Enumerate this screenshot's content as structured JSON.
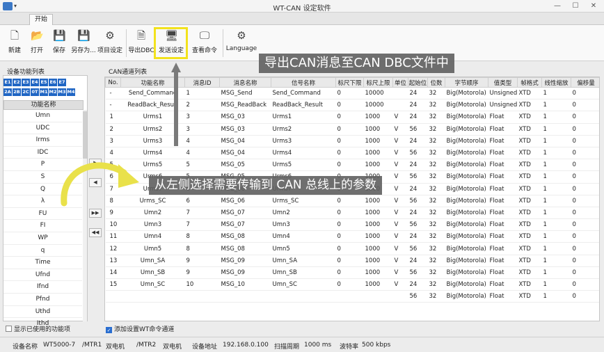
{
  "window": {
    "title": "WT-CAN 设定软件",
    "min": "—",
    "max": "☐",
    "close": "✕"
  },
  "tabs": [
    {
      "label": "开始"
    }
  ],
  "toolbar": {
    "new": "新建",
    "open": "打开",
    "save": "保存",
    "save_as": "另存为...",
    "project_settings": "项目设定",
    "export_dbc": "导出DBC",
    "send_settings": "发送设定",
    "view_commands": "查看命令",
    "language": "Language"
  },
  "left_panel": {
    "title": "设备功能列表",
    "badges": [
      "E1",
      "E2",
      "E3",
      "E4",
      "E5",
      "E6",
      "E7",
      "2A",
      "2B",
      "2C",
      "0T",
      "M1",
      "M2",
      "M3",
      "M4"
    ],
    "column_header": "功能名称",
    "items": [
      "Umn",
      "UDC",
      "Irms",
      "IDC",
      "P",
      "S",
      "Q",
      "λ",
      "FU",
      "FI",
      "WP",
      "q",
      "Time",
      "Ufnd",
      "Ifnd",
      "Pfnd",
      "Uthd",
      "Ithd"
    ]
  },
  "move_buttons": {
    "add_one": "▶",
    "remove_one": "◀",
    "add_all": "▶▶",
    "remove_all": "◀◀"
  },
  "grid": {
    "title": "CAN通道列表",
    "columns": [
      "No.",
      "功能名称",
      "消息ID",
      "消息名称",
      "信号名称",
      "标尺下限",
      "标尺上限",
      "单位",
      "起始位",
      "位数",
      "字节顺序",
      "值类型",
      "帧格式",
      "线性缩放",
      "偏移量"
    ],
    "rows": [
      [
        "-",
        "Send_Command",
        "1",
        "MSG_Send",
        "Send_Command",
        "0",
        "10000",
        "",
        "24",
        "32",
        "Big(Motorola)",
        "Unsigned",
        "XTD",
        "1",
        "0"
      ],
      [
        "-",
        "ReadBack_Result",
        "2",
        "MSG_ReadBack",
        "ReadBack_Result",
        "0",
        "10000",
        "",
        "24",
        "32",
        "Big(Motorola)",
        "Unsigned",
        "XTD",
        "1",
        "0"
      ],
      [
        "1",
        "Urms1",
        "3",
        "MSG_03",
        "Urms1",
        "0",
        "1000",
        "V",
        "24",
        "32",
        "Big(Motorola)",
        "Float",
        "XTD",
        "1",
        "0"
      ],
      [
        "2",
        "Urms2",
        "3",
        "MSG_03",
        "Urms2",
        "0",
        "1000",
        "V",
        "56",
        "32",
        "Big(Motorola)",
        "Float",
        "XTD",
        "1",
        "0"
      ],
      [
        "3",
        "Urms3",
        "4",
        "MSG_04",
        "Urms3",
        "0",
        "1000",
        "V",
        "24",
        "32",
        "Big(Motorola)",
        "Float",
        "XTD",
        "1",
        "0"
      ],
      [
        "4",
        "Urms4",
        "4",
        "MSG_04",
        "Urms4",
        "0",
        "1000",
        "V",
        "56",
        "32",
        "Big(Motorola)",
        "Float",
        "XTD",
        "1",
        "0"
      ],
      [
        "5",
        "Urms5",
        "5",
        "MSG_05",
        "Urms5",
        "0",
        "1000",
        "V",
        "24",
        "32",
        "Big(Motorola)",
        "Float",
        "XTD",
        "1",
        "0"
      ],
      [
        "6",
        "Urms6",
        "5",
        "MSG_05",
        "Urms6",
        "0",
        "1000",
        "V",
        "56",
        "32",
        "Big(Motorola)",
        "Float",
        "XTD",
        "1",
        "0"
      ],
      [
        "7",
        "Urms7",
        "6",
        "MSG_06",
        "Urms7",
        "0",
        "1000",
        "V",
        "24",
        "32",
        "Big(Motorola)",
        "Float",
        "XTD",
        "1",
        "0"
      ],
      [
        "8",
        "Urms_SC",
        "6",
        "MSG_06",
        "Urms_SC",
        "0",
        "1000",
        "V",
        "56",
        "32",
        "Big(Motorola)",
        "Float",
        "XTD",
        "1",
        "0"
      ],
      [
        "9",
        "Umn2",
        "7",
        "MSG_07",
        "Umn2",
        "0",
        "1000",
        "V",
        "24",
        "32",
        "Big(Motorola)",
        "Float",
        "XTD",
        "1",
        "0"
      ],
      [
        "10",
        "Umn3",
        "7",
        "MSG_07",
        "Umn3",
        "0",
        "1000",
        "V",
        "56",
        "32",
        "Big(Motorola)",
        "Float",
        "XTD",
        "1",
        "0"
      ],
      [
        "11",
        "Umn4",
        "8",
        "MSG_08",
        "Umn4",
        "0",
        "1000",
        "V",
        "24",
        "32",
        "Big(Motorola)",
        "Float",
        "XTD",
        "1",
        "0"
      ],
      [
        "12",
        "Umn5",
        "8",
        "MSG_08",
        "Umn5",
        "0",
        "1000",
        "V",
        "56",
        "32",
        "Big(Motorola)",
        "Float",
        "XTD",
        "1",
        "0"
      ],
      [
        "13",
        "Umn_SA",
        "9",
        "MSG_09",
        "Umn_SA",
        "0",
        "1000",
        "V",
        "24",
        "32",
        "Big(Motorola)",
        "Float",
        "XTD",
        "1",
        "0"
      ],
      [
        "14",
        "Umn_SB",
        "9",
        "MSG_09",
        "Umn_SB",
        "0",
        "1000",
        "V",
        "56",
        "32",
        "Big(Motorola)",
        "Float",
        "XTD",
        "1",
        "0"
      ],
      [
        "15",
        "Umn_SC",
        "10",
        "MSG_10",
        "Umn_SC",
        "0",
        "1000",
        "V",
        "24",
        "32",
        "Big(Motorola)",
        "Float",
        "XTD",
        "1",
        "0"
      ],
      [
        "",
        "",
        "",
        "",
        "",
        "",
        "",
        "",
        "56",
        "32",
        "Big(Motorola)",
        "Float",
        "XTD",
        "1",
        "0"
      ]
    ]
  },
  "footer": {
    "show_used": "显示已使用的功能项",
    "add_wt_channel": "添加设置WT命令通道"
  },
  "status": {
    "device_label": "设备名称",
    "device": "WT5000-7",
    "mtr1": "/MTR1",
    "mtr1_val": "双电机",
    "mtr2": "/MTR2",
    "mtr2_val": "双电机",
    "addr_label": "设备地址",
    "addr": "192.168.0.100",
    "interval_label": "扫描周期",
    "interval": "1000 ms",
    "baud_label": "波特率",
    "baud": "500 kbps"
  },
  "callouts": {
    "export": "导出CAN消息至CAN DBC文件中",
    "select": "从左侧选择需要传输到 CAN 总线上的参数"
  },
  "colors": {
    "accent": "#2066c4",
    "highlight": "#f2e21d",
    "callout_bg": "#5f5f5f"
  }
}
